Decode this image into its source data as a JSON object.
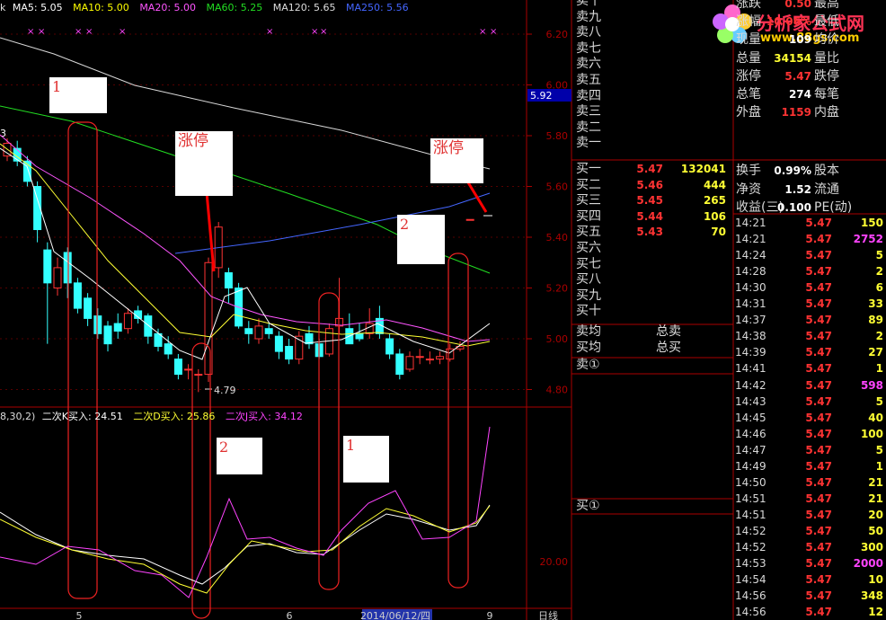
{
  "header": {
    "prefix": "k",
    "ma": [
      {
        "label": "MA5: 5.05",
        "color": "#ffffff"
      },
      {
        "label": "MA10: 5.00",
        "color": "#ffff00"
      },
      {
        "label": "MA20: 5.00",
        "color": "#ff55ff"
      },
      {
        "label": "MA60: 5.25",
        "color": "#22dd22"
      },
      {
        "label": "MA120: 5.65",
        "color": "#dddddd"
      },
      {
        "label": "MA250: 5.56",
        "color": "#4466ff"
      }
    ]
  },
  "price_axis": {
    "ticks": [
      "6.20",
      "6.00",
      "5.80",
      "5.60",
      "5.40",
      "5.20",
      "5.00",
      "4.80"
    ],
    "current": "5.92"
  },
  "indicator": {
    "prefix": "8,30,2)",
    "labels": [
      {
        "label": "二次K买入: 24.51",
        "color": "#ffffff"
      },
      {
        "label": "二次D买入: 25.86",
        "color": "#ffff33"
      },
      {
        "label": "二次J买入: 34.12",
        "color": "#ff44ff"
      }
    ],
    "axis_tick": "20.00"
  },
  "x_axis": {
    "labels": [
      "5",
      "6",
      "2014/06/12/四",
      "9"
    ],
    "period": "日线"
  },
  "annotations": {
    "low_marker": "4.79",
    "top_box_1": "1",
    "top_box_limit1": "涨停",
    "top_box_limit2": "涨停",
    "top_box_2": "2",
    "bot_box_2": "2",
    "bot_box_1": "1",
    "left_tick": "3"
  },
  "logo": {
    "text": "分析家公式网",
    "url": "www.88gs.com"
  },
  "sell_orders": [
    {
      "label": "卖十",
      "price": "",
      "volume": ""
    },
    {
      "label": "卖九",
      "price": "",
      "volume": ""
    },
    {
      "label": "卖八",
      "price": "",
      "volume": ""
    },
    {
      "label": "卖七",
      "price": "",
      "volume": ""
    },
    {
      "label": "卖六",
      "price": "",
      "volume": ""
    },
    {
      "label": "卖五",
      "price": "",
      "volume": ""
    },
    {
      "label": "卖四",
      "price": "",
      "volume": ""
    },
    {
      "label": "卖三",
      "price": "",
      "volume": ""
    },
    {
      "label": "卖二",
      "price": "",
      "volume": ""
    },
    {
      "label": "卖一",
      "price": "",
      "volume": ""
    }
  ],
  "buy_orders": [
    {
      "label": "买一",
      "price": "5.47",
      "volume": "132041"
    },
    {
      "label": "买二",
      "price": "5.46",
      "volume": "444"
    },
    {
      "label": "买三",
      "price": "5.45",
      "volume": "265"
    },
    {
      "label": "买四",
      "price": "5.44",
      "volume": "106"
    },
    {
      "label": "买五",
      "price": "5.43",
      "volume": "70"
    },
    {
      "label": "买六",
      "price": "",
      "volume": ""
    },
    {
      "label": "买七",
      "price": "",
      "volume": ""
    },
    {
      "label": "买八",
      "price": "",
      "volume": ""
    },
    {
      "label": "买九",
      "price": "",
      "volume": ""
    },
    {
      "label": "买十",
      "price": "",
      "volume": ""
    }
  ],
  "averages": [
    {
      "label": "卖均",
      "right": "总卖"
    },
    {
      "label": "买均",
      "right": "总买"
    }
  ],
  "sell_queue_label": "卖①",
  "buy_queue_label": "买①",
  "stats": [
    {
      "k1": "涨跌",
      "v1": "0.50",
      "k2": "最高",
      "color": "#ff3333"
    },
    {
      "k1": "涨幅",
      "v1": "10.06%",
      "k2": "最低",
      "color": "#ff3333"
    },
    {
      "k1": "现量",
      "v1": "109",
      "k2": "均价",
      "color": "#ffffff"
    },
    {
      "k1": "总量",
      "v1": "34154",
      "k2": "量比",
      "color": "#ffff33"
    },
    {
      "k1": "涨停",
      "v1": "5.47",
      "k2": "跌停",
      "color": "#ff3333"
    },
    {
      "k1": "总笔",
      "v1": "274",
      "k2": "每笔",
      "color": "#ffffff"
    },
    {
      "k1": "外盘",
      "v1": "1159",
      "k2": "内盘",
      "color": "#ff3333"
    },
    {
      "k1": "换手",
      "v1": "0.99%",
      "k2": "股本",
      "color": "#ffffff"
    },
    {
      "k1": "净资",
      "v1": "1.52",
      "k2": "流通",
      "color": "#ffffff"
    },
    {
      "k1": "收益(三)",
      "v1": "0.100",
      "k2": "PE(动)",
      "color": "#ffffff"
    }
  ],
  "trades": [
    {
      "time": "14:21",
      "price": "5.47",
      "vol": "150",
      "color": "#ffff33"
    },
    {
      "time": "14:21",
      "price": "5.47",
      "vol": "2752",
      "color": "#ff44ff"
    },
    {
      "time": "14:24",
      "price": "5.47",
      "vol": "5",
      "color": "#ffff33"
    },
    {
      "time": "14:28",
      "price": "5.47",
      "vol": "2",
      "color": "#ffff33"
    },
    {
      "time": "14:30",
      "price": "5.47",
      "vol": "6",
      "color": "#ffff33"
    },
    {
      "time": "14:31",
      "price": "5.47",
      "vol": "33",
      "color": "#ffff33"
    },
    {
      "time": "14:37",
      "price": "5.47",
      "vol": "89",
      "color": "#ffff33"
    },
    {
      "time": "14:38",
      "price": "5.47",
      "vol": "2",
      "color": "#ffff33"
    },
    {
      "time": "14:39",
      "price": "5.47",
      "vol": "27",
      "color": "#ffff33"
    },
    {
      "time": "14:41",
      "price": "5.47",
      "vol": "1",
      "color": "#ffff33"
    },
    {
      "time": "14:42",
      "price": "5.47",
      "vol": "598",
      "color": "#ff44ff"
    },
    {
      "time": "14:43",
      "price": "5.47",
      "vol": "5",
      "color": "#ffff33"
    },
    {
      "time": "14:45",
      "price": "5.47",
      "vol": "40",
      "color": "#ffff33"
    },
    {
      "time": "14:46",
      "price": "5.47",
      "vol": "100",
      "color": "#ffff33"
    },
    {
      "time": "14:47",
      "price": "5.47",
      "vol": "5",
      "color": "#ffff33"
    },
    {
      "time": "14:49",
      "price": "5.47",
      "vol": "1",
      "color": "#ffff33"
    },
    {
      "time": "14:50",
      "price": "5.47",
      "vol": "21",
      "color": "#ffff33"
    },
    {
      "time": "14:51",
      "price": "5.47",
      "vol": "21",
      "color": "#ffff33"
    },
    {
      "time": "14:51",
      "price": "5.47",
      "vol": "20",
      "color": "#ffff33"
    },
    {
      "time": "14:52",
      "price": "5.47",
      "vol": "50",
      "color": "#ffff33"
    },
    {
      "time": "14:52",
      "price": "5.47",
      "vol": "300",
      "color": "#ffff33"
    },
    {
      "time": "14:53",
      "price": "5.47",
      "vol": "2000",
      "color": "#ff44ff"
    },
    {
      "time": "14:54",
      "price": "5.47",
      "vol": "10",
      "color": "#ffff33"
    },
    {
      "time": "14:56",
      "price": "5.47",
      "vol": "348",
      "color": "#ffff33"
    },
    {
      "time": "14:56",
      "price": "5.47",
      "vol": "12",
      "color": "#ffff33"
    }
  ],
  "colors": {
    "grid": "#aa0000",
    "up": "#ff3333",
    "down": "#33ffff",
    "limit_arrow": "#ff0000"
  }
}
